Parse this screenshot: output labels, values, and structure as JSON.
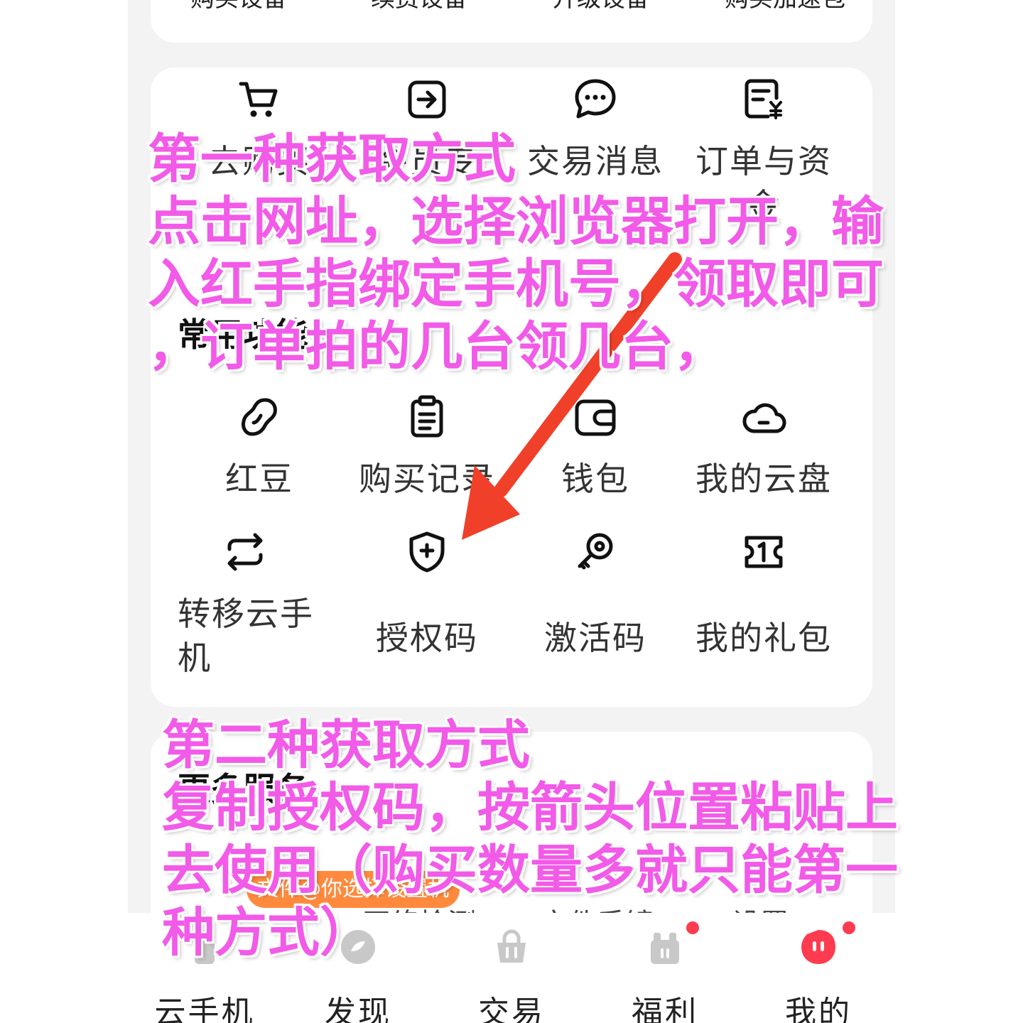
{
  "top_row": [
    "购买设备",
    "续费设备",
    "升级设备",
    "购买加速包"
  ],
  "services_row1": [
    {
      "label": "去购买",
      "icon": "cart-icon"
    },
    {
      "label": "会员专",
      "icon": "enter-icon"
    },
    {
      "label": "交易消息",
      "icon": "chat-icon"
    },
    {
      "label": "订单与资金",
      "icon": "receipt-yen-icon"
    }
  ],
  "common_title": "常用功能",
  "services_row2": [
    {
      "label": "红豆",
      "icon": "bean-icon"
    },
    {
      "label": "购买记录",
      "icon": "clipboard-icon"
    },
    {
      "label": "钱包",
      "icon": "wallet-icon"
    },
    {
      "label": "我的云盘",
      "icon": "cloud-icon"
    }
  ],
  "services_row3": [
    {
      "label": "转移云手机",
      "icon": "transfer-icon"
    },
    {
      "label": "授权码",
      "icon": "shield-plus-icon"
    },
    {
      "label": "激活码",
      "icon": "key-icon"
    },
    {
      "label": "我的礼包",
      "icon": "ticket-icon"
    }
  ],
  "more_title": "更多服务",
  "more_row": [
    "网络检测",
    "文件手镜",
    "设置"
  ],
  "pill_text": "文件@你选择设置机",
  "tabs": [
    {
      "label": "云手机",
      "icon": "phone-icon"
    },
    {
      "label": "发现",
      "icon": "compass-icon"
    },
    {
      "label": "交易",
      "icon": "basket-icon"
    },
    {
      "label": "福利",
      "icon": "gift-icon"
    },
    {
      "label": "我的",
      "icon": "profile-icon"
    }
  ],
  "overlay_1": [
    "第一种获取方式",
    "点击网址，选择浏览器打开，输",
    "入红手指绑定手机号，领取即可",
    "，订单拍的几台领几台，"
  ],
  "overlay_2": [
    "第二种获取方式",
    "复制授权码，按箭头位置粘贴上",
    "去使用（购买数量多就只能第一",
    "种方式）"
  ],
  "colors": {
    "overlay_text": "#f25ae8",
    "arrow": "#f0402a",
    "badge": "#ff3b4f",
    "background": "#f3f3f3"
  }
}
